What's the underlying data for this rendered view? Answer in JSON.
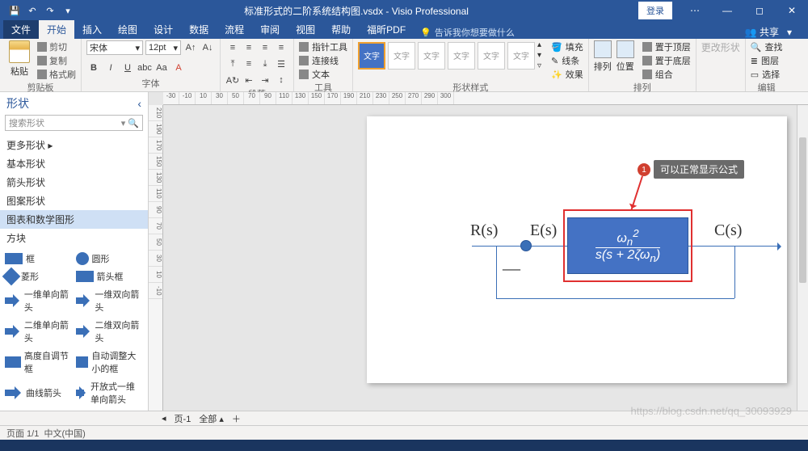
{
  "titlebar": {
    "filename": "标准形式的二阶系统结构图.vsdx",
    "app": "Visio Professional",
    "login": "登录"
  },
  "tabs": {
    "file": "文件",
    "home": "开始",
    "insert": "插入",
    "draw": "绘图",
    "design": "设计",
    "data": "数据",
    "process": "流程",
    "review": "审阅",
    "view": "视图",
    "help": "帮助",
    "foxit": "福昕PDF",
    "tell": "告诉我你想要做什么",
    "share": "共享"
  },
  "ribbon": {
    "clipboard": {
      "paste": "粘贴",
      "cut": "剪切",
      "copy": "复制",
      "format": "格式刷",
      "label": "剪贴板"
    },
    "font": {
      "name": "宋体",
      "size": "12pt",
      "label": "字体"
    },
    "paragraph": {
      "label": "段落"
    },
    "tools": {
      "pointer": "指针工具",
      "connector": "连接线",
      "text": "文本",
      "label": "工具"
    },
    "styles": {
      "text": "文字",
      "fill": "填充",
      "line": "线条",
      "effect": "效果",
      "label": "形状样式"
    },
    "arrange": {
      "align": "排列",
      "position": "位置",
      "front": "置于顶层",
      "back": "置于底层",
      "group": "组合",
      "label": "排列"
    },
    "change": {
      "label": "更改形状"
    },
    "edit": {
      "find": "查找",
      "layer": "图层",
      "select": "选择",
      "label": "编辑"
    }
  },
  "shapes": {
    "title": "形状",
    "search": "搜索形状",
    "cats": {
      "more": "更多形状",
      "basic": "基本形状",
      "arrow": "箭头形状",
      "pattern": "图案形状",
      "chart": "图表和数学图形",
      "block": "方块"
    },
    "items": {
      "rect": "框",
      "circle": "圆形",
      "diamond": "菱形",
      "arrowbox": "箭头框",
      "arrow1d": "一维单向箭头",
      "arrow1db": "一维双向箭头",
      "arrow2d": "二维单向箭头",
      "arrow2db": "二维双向箭头",
      "autoheight": "高度自调节框",
      "autosize": "自动调整大小的框",
      "curve": "曲线箭头",
      "open1d": "开放式一维单向箭头"
    }
  },
  "diagram": {
    "R": "R(s)",
    "E": "E(s)",
    "C": "C(s)",
    "minus": "—",
    "num": "ω",
    "num_sub": "n",
    "num_sup": "2",
    "den": "s(s + 2ζω",
    "den_sub": "n",
    "den_end": ")",
    "callout": "可以正常显示公式",
    "callout_num": "1"
  },
  "pagetabs": {
    "page1": "页-1",
    "all": "全部"
  },
  "status": {
    "page": "页面 1/1",
    "lang": "中文(中国)"
  },
  "ruler_h": [
    "-30",
    "-10",
    "10",
    "30",
    "50",
    "70",
    "90",
    "110",
    "130",
    "150",
    "170",
    "190",
    "210",
    "230",
    "250",
    "270",
    "290",
    "300"
  ],
  "ruler_v": [
    "210",
    "190",
    "170",
    "150",
    "130",
    "110",
    "90",
    "70",
    "50",
    "30",
    "10",
    "-10"
  ]
}
